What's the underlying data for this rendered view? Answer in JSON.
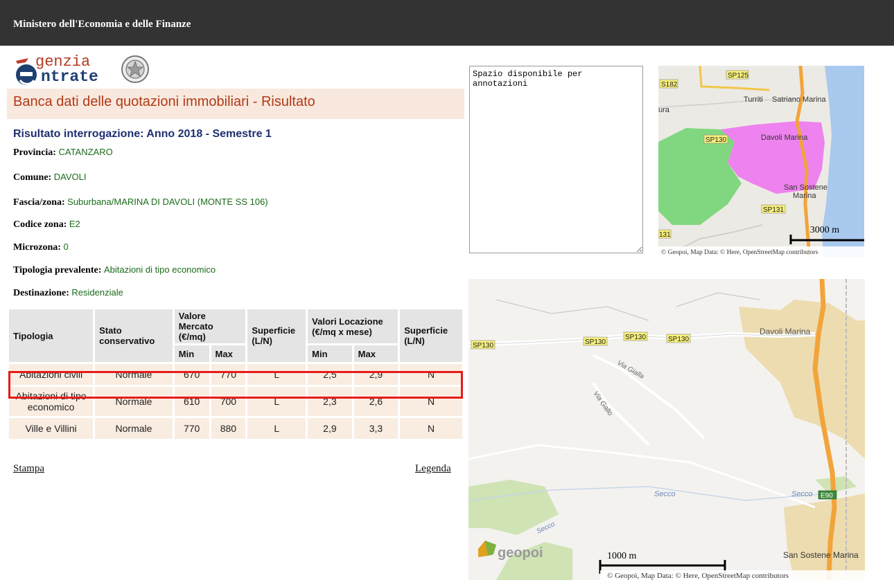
{
  "header": {
    "title": "Ministero dell'Economia e delle Finanze"
  },
  "logo": {
    "line1": "genzia",
    "line2": "ntrate"
  },
  "page": {
    "heading": "Banca dati delle quotazioni immobiliari - Risultato",
    "result_title": "Risultato interrogazione: Anno 2018 - Semestre 1"
  },
  "fields": [
    {
      "label": "Provincia:",
      "value": "CATANZARO"
    },
    {
      "label": "Comune:",
      "value": "DAVOLI"
    },
    {
      "label": "Fascia/zona:",
      "value": "Suburbana/MARINA DI DAVOLI (MONTE SS 106)"
    },
    {
      "label": "Codice zona:",
      "value": "E2"
    },
    {
      "label": "Microzona:",
      "value": "0"
    },
    {
      "label": "Tipologia prevalente:",
      "value": "Abitazioni di tipo economico"
    },
    {
      "label": "Destinazione:",
      "value": "Residenziale"
    }
  ],
  "table": {
    "headers": {
      "tipologia": "Tipologia",
      "stato": "Stato conservativo",
      "valore_mercato": "Valore Mercato (€/mq)",
      "superficie": "Superficie (L/N)",
      "valori_locazione": "Valori Locazione (€/mq x mese)",
      "superficie2": "Superficie (L/N)",
      "min": "Min",
      "max": "Max"
    },
    "rows": [
      {
        "tipologia": "Abitazioni civili",
        "stato": "Normale",
        "vm_min": "670",
        "vm_max": "770",
        "sup": "L",
        "vl_min": "2,5",
        "vl_max": "2,9",
        "sup2": "N"
      },
      {
        "tipologia": "Abitazioni di tipo economico",
        "stato": "Normale",
        "vm_min": "610",
        "vm_max": "700",
        "sup": "L",
        "vl_min": "2,3",
        "vl_max": "2,6",
        "sup2": "N"
      },
      {
        "tipologia": "Ville e Villini",
        "stato": "Normale",
        "vm_min": "770",
        "vm_max": "880",
        "sup": "L",
        "vl_min": "2,9",
        "vl_max": "3,3",
        "sup2": "N"
      }
    ]
  },
  "links": {
    "print": "Stampa",
    "legend": "Legenda"
  },
  "notes": {
    "value": "Spazio disponibile per annotazioni"
  },
  "map_small": {
    "labels": {
      "sp125": "SP125",
      "s182": "S182",
      "turriti": "Turriti",
      "satriano": "Satriano Marina",
      "ura": "ura",
      "sp130": "SP130",
      "davoli": "Davoli Marina",
      "san_sostene": "San Sostene",
      "marina": "Marina",
      "sp131": "SP131",
      "p131": "131"
    },
    "scale": "3000 m",
    "attribution": "© Geopoi, Map Data: © Here, OpenStreetMap contributors",
    "attribution_links": [
      "Here",
      "OpenStreetMap contributors"
    ]
  },
  "map_large": {
    "labels": {
      "sp130_a": "SP130",
      "sp130_b": "SP130",
      "sp130_c": "SP130",
      "sp130_d": "SP130",
      "davoli": "Davoli Marina",
      "via_gialla": "Via Gialla",
      "via_gallo": "Via Gallo",
      "secco_a": "Secco",
      "secco_b": "Secco",
      "secco_c": "Secco",
      "e90": "E90",
      "san_sostene": "San Sostene Marina"
    },
    "scale": "1000 m",
    "brand": "geopoi",
    "attribution": "© Geopoi, Map Data: © Here, OpenStreetMap contributors"
  },
  "colors": {
    "topbar": "#333333",
    "heading_band": "#f9e8de",
    "heading_text": "#b03a16",
    "result_title": "#1f2f6f",
    "field_value": "#1a6b1a",
    "cell_bg": "#f9ece0",
    "header_bg": "#e4e4e4",
    "highlight": "#e51b1b"
  }
}
